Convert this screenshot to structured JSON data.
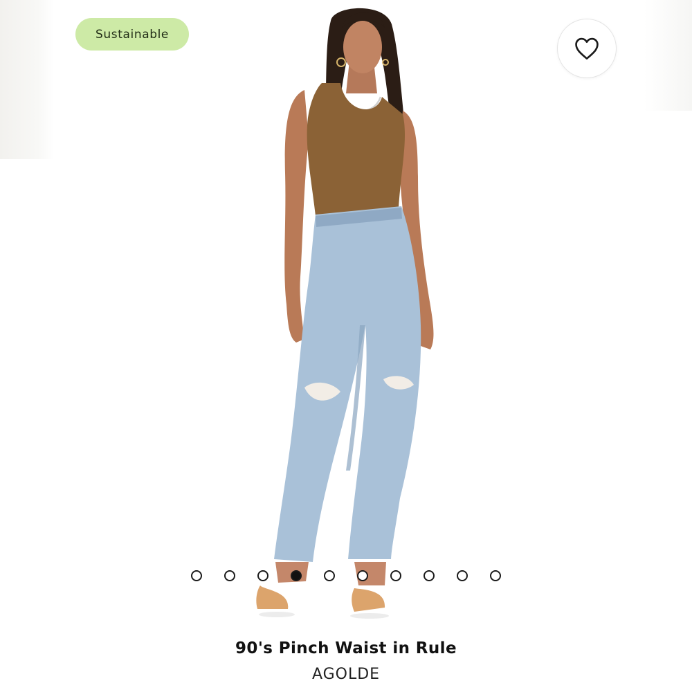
{
  "product": {
    "badge_label": "Sustainable",
    "title": "90's Pinch Waist in Rule",
    "brand": "AGOLDE",
    "image_icon": "product-model-photo"
  },
  "actions": {
    "favorite_icon": "heart-outline-icon"
  },
  "carousel": {
    "total_slides": 10,
    "active_index": 3
  },
  "colors": {
    "badge_bg": "#cdeaa6",
    "top": "#8b6236",
    "denim": "#a9c1d8",
    "sandal": "#dca46c"
  }
}
